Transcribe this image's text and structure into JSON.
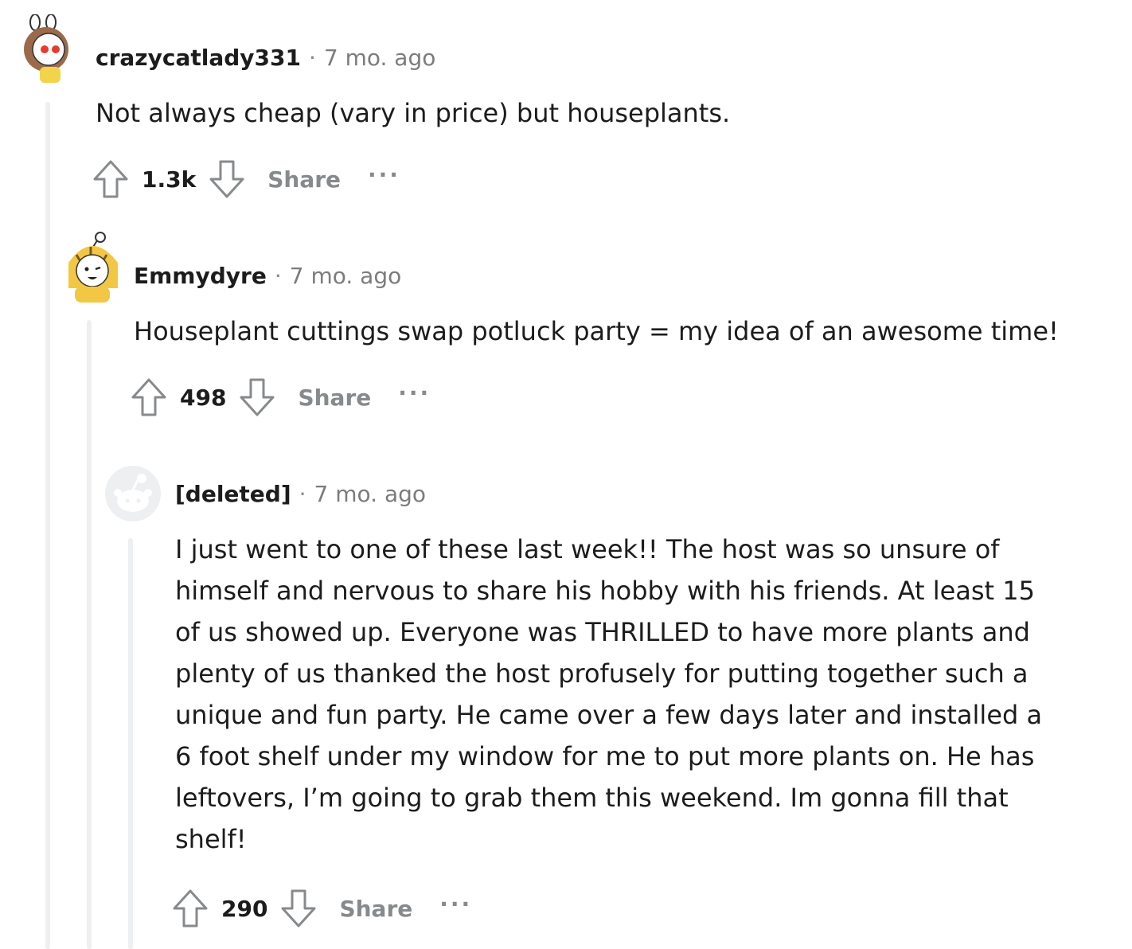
{
  "comments": [
    {
      "author": "crazycatlady331",
      "separator": "·",
      "time": "7 mo. ago",
      "body": "Not always cheap (vary in price) but houseplants.",
      "score": "1.3k",
      "share_label": "Share",
      "more_label": "···"
    },
    {
      "author": "Emmydyre",
      "separator": "·",
      "time": "7 mo. ago",
      "body": "Houseplant cuttings swap potluck party = my idea of an awesome time!",
      "score": "498",
      "share_label": "Share",
      "more_label": "···"
    },
    {
      "author": "[deleted]",
      "separator": "·",
      "time": "7 mo. ago",
      "body": "I just went to one of these last week!! The host was so unsure of\nhimself and nervous to share his hobby with his friends. At least 15\nof us showed up. Everyone was THRILLED to have more plants and\nplenty of us thanked the host profusely for putting together such a\nunique and fun party. He came over a few days later and installed a\n6 foot shelf under my window for me to put more plants on. He has\nleftovers, I’m going to grab them this weekend. Im gonna fill that\nshelf!",
      "score": "290",
      "share_label": "Share",
      "more_label": "···"
    }
  ]
}
